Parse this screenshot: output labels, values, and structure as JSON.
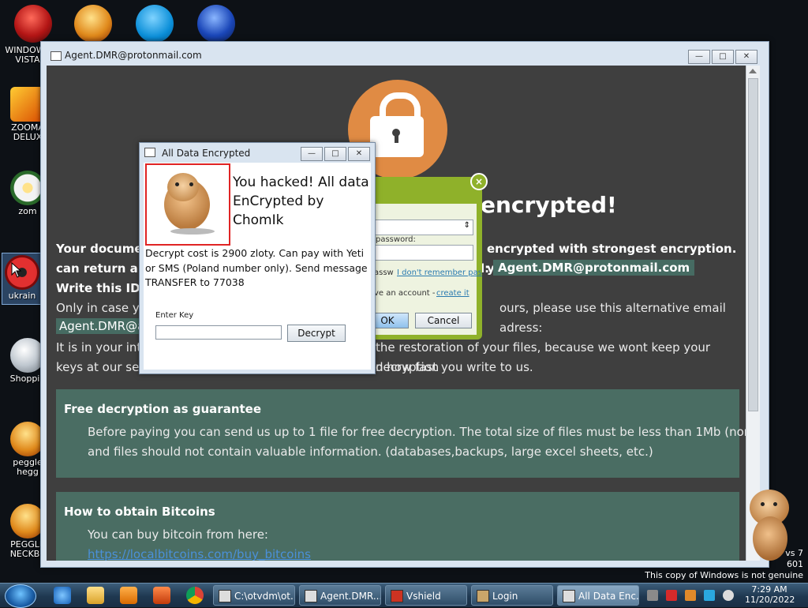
{
  "desktop": {
    "icons": [
      {
        "label": "WINDOWS VISTA"
      },
      {
        "label": "ZOOMA DELUX"
      },
      {
        "label": "zom"
      },
      {
        "label": "ukrain"
      },
      {
        "label": "Shoppin"
      },
      {
        "label": "peggle hegg"
      },
      {
        "label": "PEGGLE NECKBE"
      }
    ]
  },
  "ransom_window": {
    "title": "Agent.DMR@protonmail.com",
    "headline": "encrypted!",
    "para1_start": "Your documen",
    "para1_end": "encrypted with strongest encryption. you",
    "para2_start": "can return all",
    "para2_mid": "l:",
    "email_main": "Agent.DMR@protonmail.com",
    "para3": "Write this ID i",
    "para4_start": "Only in case you",
    "para4_end": "ours, please use this alternative email adress:",
    "email_alt": "Agent.DMR@ac",
    "para5_start": "It is in your inter",
    "para5_end": "the restoration of your files, because we wont keep your decryption",
    "para6_start": "keys at our serv",
    "para6_end": "n how fast you write to us.",
    "panel1_title": "Free decryption as guarantee",
    "panel1_text1": "Before paying you can send us up to 1 file for free decryption. The total size of files must be less than 1Mb (non archived),",
    "panel1_text2": "and files should not contain valuable information. (databases,backups, large excel sheets, etc.)",
    "panel2_title": "How to obtain Bitcoins",
    "panel2_text": "You can buy bitcoin from here:",
    "panel2_link": "https://localbitcoins.com/buy_bitcoins"
  },
  "login_window": {
    "password_label": "password:",
    "remember_label": "assw",
    "forgot_link": "I don't remember pas",
    "account_text": "ve an account -",
    "create_link": "create it",
    "ok_label": "OK",
    "cancel_label": "Cancel",
    "close_glyph": "×"
  },
  "enc_dialog": {
    "title": "All Data Encrypted",
    "heading": "You hacked! All data EnCrypted by ChomIk",
    "body": "Decrypt cost is 2900 zloty. Can pay with Yeti or SMS (Poland number only). Send message TRANSFER to 77038",
    "key_label": "Enter Key",
    "key_value": "",
    "decrypt_label": "Decrypt"
  },
  "taskbar": {
    "buttons": [
      {
        "label": "C:\\otvdm\\ot..."
      },
      {
        "label": "Agent.DMR..."
      },
      {
        "label": "Vshield"
      },
      {
        "label": "Login"
      },
      {
        "label": "All Data Enc..."
      }
    ],
    "time": "7:29 AM",
    "date": "11/20/2022"
  },
  "watermark": {
    "version_line1": "vs 7",
    "version_line2": "601",
    "genuine": "This copy of Windows is not genuine"
  },
  "colors": {
    "page_bg": "#3f3f3f",
    "accent_orange": "#e08b44",
    "panel_green": "#4a6d63",
    "login_green": "#8fb12a",
    "red_border": "#e02424"
  }
}
